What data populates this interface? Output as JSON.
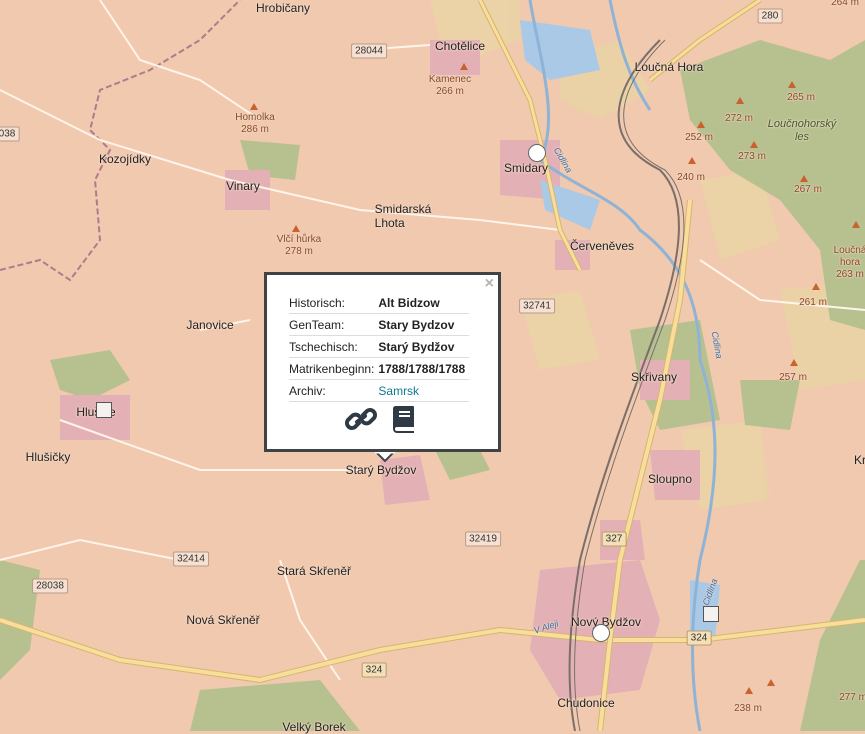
{
  "map": {
    "places": [
      {
        "id": "hrobicany",
        "label": "Hrobičany",
        "cls": "town"
      },
      {
        "id": "chotelice",
        "label": "Chotělice",
        "cls": "town"
      },
      {
        "id": "loucna-hora",
        "label": "Loučná Hora",
        "cls": "town"
      },
      {
        "id": "kozojidky",
        "label": "Kozojídky",
        "cls": "town"
      },
      {
        "id": "vinary",
        "label": "Vinary",
        "cls": "town"
      },
      {
        "id": "smidary",
        "label": "Smidary",
        "cls": "town"
      },
      {
        "id": "smidarska-lhota",
        "label": "Smidarská\nLhota",
        "cls": "town"
      },
      {
        "id": "cerveneves",
        "label": "Červeněves",
        "cls": "town"
      },
      {
        "id": "janovice",
        "label": "Janovice",
        "cls": "town"
      },
      {
        "id": "skrivany",
        "label": "Skřivany",
        "cls": "town"
      },
      {
        "id": "hlusice",
        "label": "Hlušice",
        "cls": "town"
      },
      {
        "id": "hlusicky",
        "label": "Hlušičky",
        "cls": "town"
      },
      {
        "id": "stary-bydzov",
        "label": "Starý Bydžov",
        "cls": "town"
      },
      {
        "id": "sloupno",
        "label": "Sloupno",
        "cls": "town"
      },
      {
        "id": "stara-skrener",
        "label": "Stará Skřeněř",
        "cls": "town"
      },
      {
        "id": "nova-skrener",
        "label": "Nová Skřeněř",
        "cls": "town"
      },
      {
        "id": "novy-bydzov",
        "label": "Nový Bydžov",
        "cls": "town"
      },
      {
        "id": "chudonice",
        "label": "Chudonice",
        "cls": "town"
      },
      {
        "id": "velky-borek",
        "label": "Velký Borek",
        "cls": "town"
      },
      {
        "id": "kr",
        "label": "Kr",
        "cls": "town"
      }
    ],
    "peaks": [
      {
        "id": "kamenec",
        "label": "Kamenec\n266 m"
      },
      {
        "id": "homolka",
        "label": "Homolka\n286 m"
      },
      {
        "id": "vlci-hurka",
        "label": "Vlčí hůrka\n278 m"
      },
      {
        "id": "p264",
        "label": "264 m"
      },
      {
        "id": "p265",
        "label": "265 m"
      },
      {
        "id": "p272",
        "label": "272 m"
      },
      {
        "id": "p252",
        "label": "252 m"
      },
      {
        "id": "p273",
        "label": "273 m"
      },
      {
        "id": "p240",
        "label": "240 m"
      },
      {
        "id": "p267",
        "label": "267 m"
      },
      {
        "id": "p263",
        "label": "Loučná\nhora\n263 m"
      },
      {
        "id": "p261",
        "label": "261 m"
      },
      {
        "id": "p257",
        "label": "257 m"
      },
      {
        "id": "p238",
        "label": "238 m"
      },
      {
        "id": "p277",
        "label": "277 m"
      }
    ],
    "forest": {
      "label": "Loučnohorský\nles"
    },
    "rivers": [
      {
        "id": "cidlina1",
        "label": "Cidlina"
      },
      {
        "id": "cidlina2",
        "label": "Cidlina"
      },
      {
        "id": "cidlina3",
        "label": "Cidlina"
      }
    ],
    "street": "V Aleji",
    "roads": [
      {
        "id": "r280",
        "label": "280",
        "gold": false
      },
      {
        "id": "r28044",
        "label": "28044",
        "gold": false
      },
      {
        "id": "r038",
        "label": "038",
        "gold": false
      },
      {
        "id": "r32741",
        "label": "32741",
        "gold": false
      },
      {
        "id": "r32414",
        "label": "32414",
        "gold": false
      },
      {
        "id": "r28038",
        "label": "28038",
        "gold": false
      },
      {
        "id": "r32419",
        "label": "32419",
        "gold": false
      },
      {
        "id": "r327",
        "label": "327",
        "gold": true
      },
      {
        "id": "r324a",
        "label": "324",
        "gold": true
      },
      {
        "id": "r324b",
        "label": "324",
        "gold": true
      }
    ]
  },
  "popup": {
    "close": "×",
    "rows": [
      {
        "key": "Historisch:",
        "value": "Alt Bidzow",
        "link": false
      },
      {
        "key": "GenTeam:",
        "value": "Stary Bydzov",
        "link": false
      },
      {
        "key": "Tschechisch:",
        "value": "Starý Bydžov",
        "link": false
      },
      {
        "key": "Matrikenbeginn:",
        "value": "1788/1788/1788",
        "link": false
      },
      {
        "key": "Archiv:",
        "value": "Samrsk",
        "link": true
      }
    ],
    "icons": [
      "link-icon",
      "book-icon"
    ]
  },
  "colors": {
    "land": "#f0c9ae",
    "forest": "#b7c08f",
    "forest_dark": "#a9b488",
    "field": "#e6d49a",
    "road_major": "#f7df9b",
    "road_edge": "#d9b46e",
    "water": "#a9c9e6",
    "river": "#8fb3d6",
    "rail": "#7a6f6a",
    "admin": "#b07a8e",
    "settlement": "#e3b1b5",
    "popup_border": "#3f4346",
    "link": "#0a7a8f",
    "icon": "#2e3a46"
  }
}
